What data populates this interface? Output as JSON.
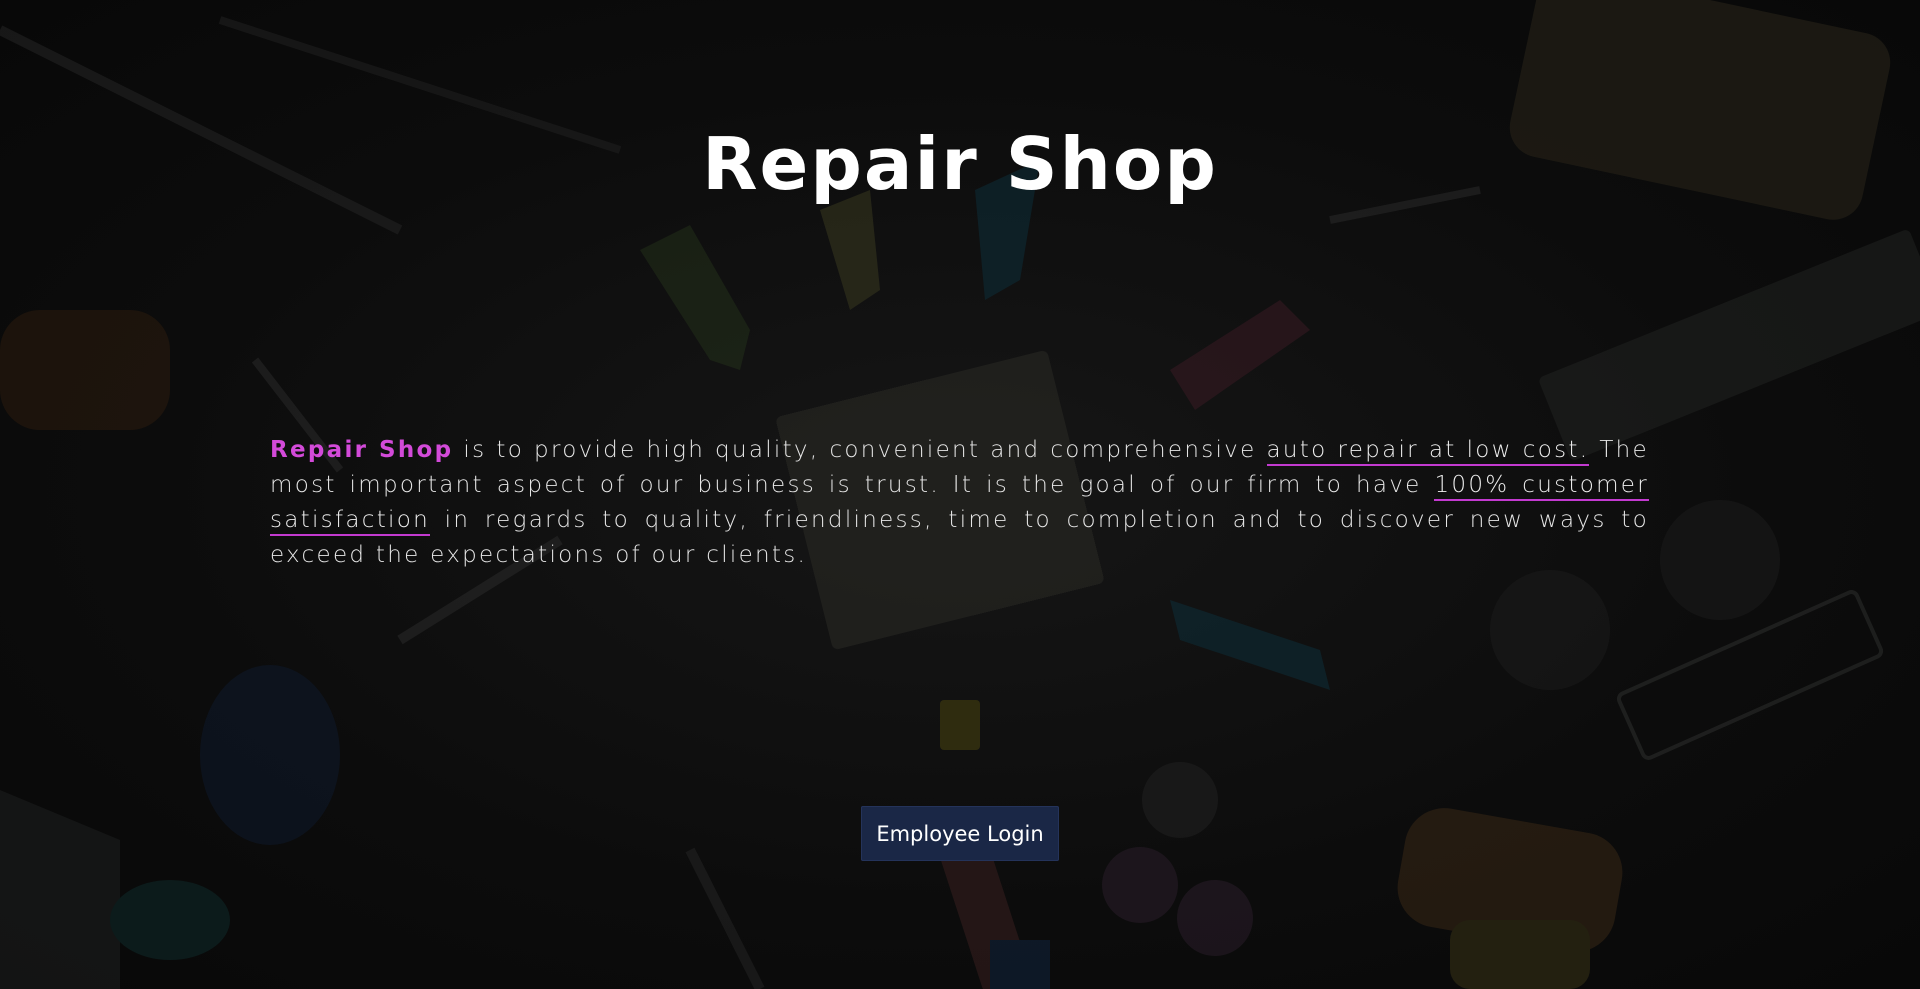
{
  "hero": {
    "title": "Repair Shop"
  },
  "mission": {
    "brand": "Repair Shop",
    "text_1": " is to provide high quality, convenient and comprehensive ",
    "link_1": "auto repair at low cost.",
    "text_2": " The most important aspect of our business is trust. It is the goal of our firm to have ",
    "link_2": "100% customer satisfaction",
    "text_3": " in regards to quality, friendliness, time to completion and to discover new ways to exceed the expectations of our clients."
  },
  "actions": {
    "login_label": "Employee Login"
  },
  "colors": {
    "accent": "#d34ad9",
    "button_bg": "#1a2746",
    "background": "#0b0b0c"
  }
}
